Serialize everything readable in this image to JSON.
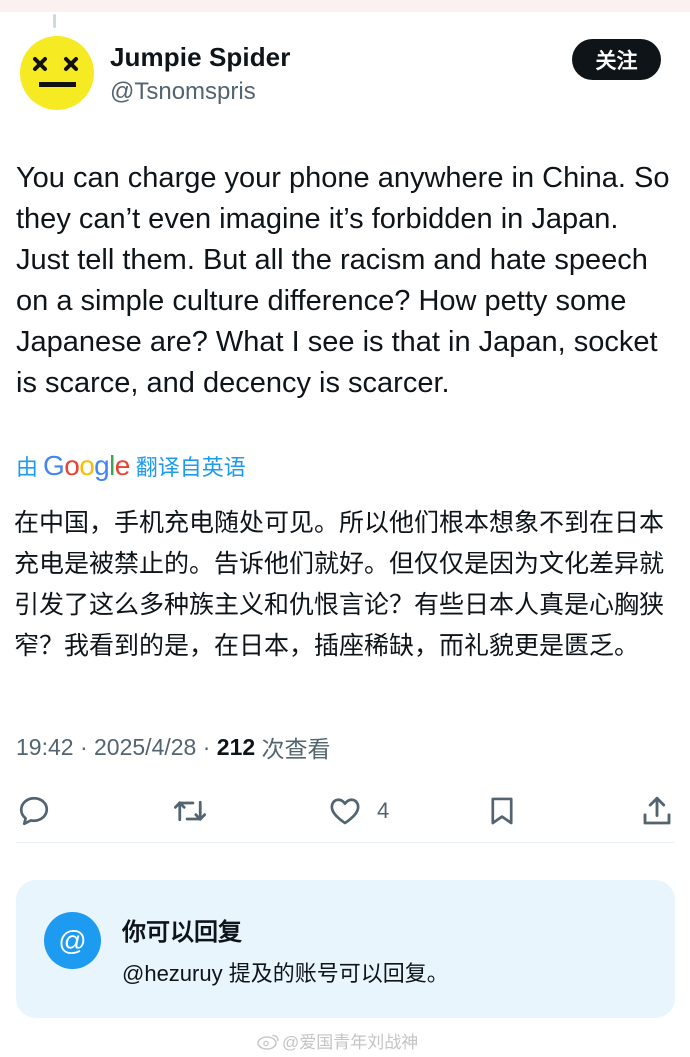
{
  "author": {
    "name": "Jumpie Spider",
    "handle": "@Tsnomspris",
    "follow_label": "关注"
  },
  "tweet": {
    "text": "You can charge your phone anywhere in China. So they can’t even imagine it’s forbidden in Japan. Just tell them. But all the racism and hate speech on a simple culture difference? How petty some Japanese are? What I see is that in Japan, socket is scarce, and decency is scarcer.",
    "translation_by": "由",
    "translation_brand": "Google",
    "translation_from": "翻译自英语",
    "translation": "在中国，手机充电随处可见。所以他们根本想象不到在日本充电是被禁止的。告诉他们就好。但仅仅是因为文化差异就引发了这么多种族主义和仇恨言论？有些日本人真是心胸狭窄？我看到的是，在日本，插座稀缺，而礼貌更是匮乏。"
  },
  "meta": {
    "time": "19:42",
    "separator": " · ",
    "date": "2025/4/28",
    "views": "212",
    "views_label": " 次查看"
  },
  "actions": {
    "icons": [
      "reply-icon",
      "retweet-icon",
      "like-icon",
      "bookmark-icon",
      "share-icon"
    ],
    "like_count": "4"
  },
  "reply_card": {
    "icon": "@",
    "title": "你可以回复",
    "subtitle": "@hezuruy 提及的账号可以回复。"
  },
  "watermark": "@爱国青年刘战神",
  "colors": {
    "accent": "#1d9bf0",
    "text": "#0f1419",
    "muted": "#536471",
    "card_bg": "#e8f5fd",
    "avatar_bg": "#f6ea23",
    "google_blue": "#4285f4",
    "google_red": "#ea4335",
    "google_yellow": "#fbbc05",
    "google_green": "#34a853"
  }
}
